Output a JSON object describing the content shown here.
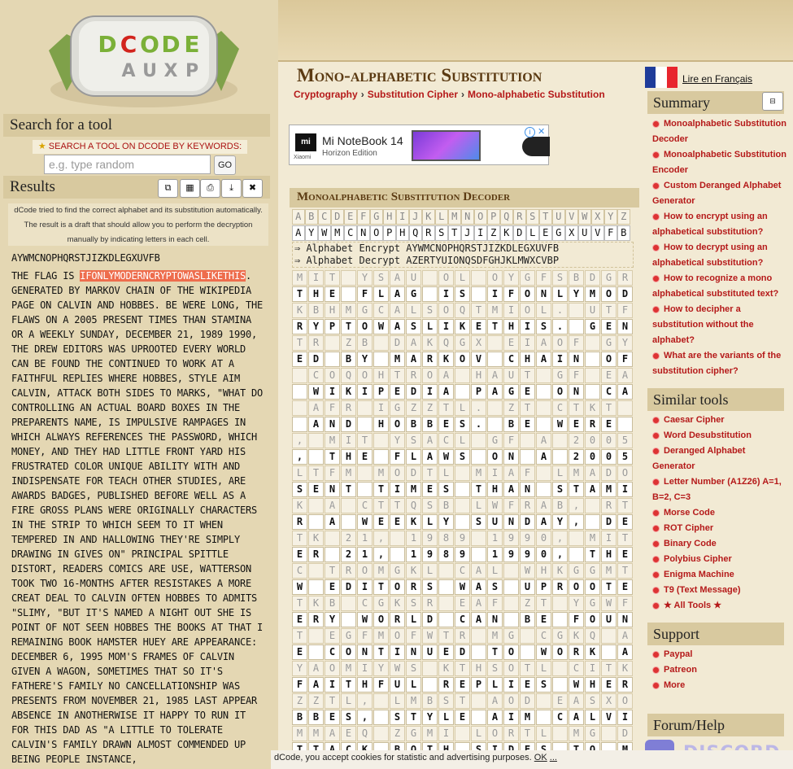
{
  "logo": {
    "letters": [
      "D",
      "C",
      "O",
      "D",
      "E"
    ],
    "under": [
      "A",
      "U",
      "X",
      "P"
    ]
  },
  "search": {
    "heading": "Search for a tool",
    "keywords_label": "SEARCH A TOOL ON DCODE BY KEYWORDS:",
    "placeholder": "e.g. type random",
    "go_label": "GO"
  },
  "results": {
    "heading": "Results",
    "buttons": {
      "copy_icon": "⧉",
      "save_icon": "▦",
      "print_icon": "⎙",
      "download_icon": "⤓",
      "close_icon": "✖"
    },
    "note": "dCode tried to find the correct alphabet and its substitution automatically. The result is a draft that should allow you to perform the decryption manually by indicating letters in each cell.",
    "alphabet": "AYWMCNOPHQRSTJIZKDLEGXUVFB",
    "text_before": "THE FLAG IS ",
    "text_flag": "IFONLYMODERNCRYPTOWASLIKETHIS",
    "text_after": ". GENERATED BY MARKOV CHAIN OF THE WIKIPEDIA PAGE ON CALVIN AND HOBBES. BE WERE LONG, THE FLAWS ON A 2005 PRESENT TIMES THAN STAMINA OR A WEEKLY SUNDAY, DECEMBER 21, 1989 1990, THE DREW EDITORS WAS UPROOTED EVERY WORLD CAN BE FOUND THE CONTINUED TO WORK AT A FAITHFUL REPLIES WHERE HOBBES, STYLE AIM CALVIN, ATTACK BOTH SIDES TO MARKS, \"WHAT DO CONTROLLING AN ACTUAL BOARD BOXES IN THE PREPARENTS NAME, IS IMPULSIVE RAMPAGES IN WHICH ALWAYS REFERENCES THE PASSWORD, WHICH MONEY, AND THEY HAD LITTLE FRONT YARD HIS FRUSTRATED COLOR UNIQUE ABILITY WITH AND INDISPENSATE FOR TEACH OTHER STUDIES, ARE AWARDS BADGES, PUBLISHED BEFORE WELL AS A FIRE GROSS PLANS WERE ORIGINALLY CHARACTERS IN THE STRIP TO WHICH SEEM TO IT WHEN TEMPERED IN AND HALLOWING THEY'RE SIMPLY DRAWING IN GIVES ON\" PRINCIPAL SPITTLE DISTORT, READERS COMICS ARE USE, WATTERSON TOOK TWO 16-MONTHS AFTER RESISTAKES A MORE CREAT DEAL TO CALVIN OFTEN HOBBES TO ADMITS \"SLIMY, \"BUT IT'S NAMED A NIGHT OUT SHE IS POINT OF NOT SEEN HOBBES THE BOOKS AT THAT I REMAINING BOOK HAMSTER HUEY ARE APPEARANCE: DECEMBER 6, 1995 MOM'S FRAMES OF CALVIN GIVEN A WAGON, SOMETIMES THAT SO IT'S FATHERE'S FAMILY NO CANCELLATIONSHIP WAS PRESENTS FROM NOVEMBER 21, 1985 LAST APPEAR ABSENCE IN ANOTHERWISE IT HAPPY TO RUN IT FOR THIS DAD AS \"A LITTLE TO TOLERATE CALVIN'S FAMILY DRAWN ALMOST COMMENDED UP BEING PEOPLE INSTANCE,"
  },
  "page": {
    "title": "Mono-alphabetic Substitution",
    "breadcrumb": [
      "Cryptography",
      "Substitution Cipher",
      "Mono-alphabetic Substitution"
    ],
    "breadcrumb_sep": "›"
  },
  "ad": {
    "brand": "mi",
    "brand_sub": "Xiaomi",
    "title": "Mi NoteBook 14",
    "subtitle": "Horizon Edition",
    "info": "i",
    "close": "✕"
  },
  "decoder": {
    "heading": "Monoalphabetic Substitution Decoder",
    "plain": "ABCDEFGHIJKLMNOPQRSTUVWXYZ",
    "cipher": "AYWMCNOPHQRSTJIZKDLEGXUVFB",
    "encrypt_label": "⇒ Alphabet Encrypt AYWMCNOPHQRSTJIZKDLEGXUVFB",
    "decrypt_label": "⇒ Alphabet Decrypt AZERTYUIONQSDFGHJKLMWXCVBP",
    "rows": [
      [
        "MIT YSAU OL OYGFSBDGRTKFE",
        "THE FLAG IS IFONLYMODERNC"
      ],
      [
        "KBHMGCALSOQTMIOL. UTFTKAM",
        "RYPTOWASLIKETHIS. GENERAT"
      ],
      [
        "TR ZB DAKQGX EIAOF GY MIT",
        "ED BY MARKOV CHAIN OF THE"
      ],
      [
        " COQOHTROA HAUT GF EASXOF",
        " WIKIPEDIA PAGE ON CALVIN"
      ],
      [
        " AFR IGZZTL. ZT CTKT SGFU",
        " AND HOBBES. BE WERE LONG"
      ],
      [
        ", MIT YSACL GF A 2005 HKT",
        ", THE FLAWS ON A 2005 PRE"
      ],
      [
        "LTFM MODTL MIAF LMADOFA G",
        "SENT TIMES THAN STAMINA O"
      ],
      [
        "K A CTTQSB LWFRAB, RTETDZ",
        "R A WEEKLY SUNDAY, DECEMB"
      ],
      [
        "TK 21, 1989 1990, MIT RKT",
        "ER 21, 1989 1990, THE DRE"
      ],
      [
        "C TROMGKL CAL WHKGGMTR TX",
        "W EDITORS WAS UPROOTED EV"
      ],
      [
        "TKB CGKSR EAF ZT YGWFR MI",
        "ERY WORLD CAN BE FOUND TH"
      ],
      [
        "T EGFMOFWTR MG CGKQ AM A",
        "E CONTINUED TO WORK AT A"
      ],
      [
        "YAOMIYWS KTHSOTL CITKT IG",
        "FAITHFUL REPLIES WHERE HO"
      ],
      [
        "ZZTL, LMBST AOD EASXOF, A",
        "BBES, STYLE AIM CALVIN, A"
      ],
      [
        "MMAEQ ZGMI LORTL MG DAKQL",
        "TTACK BOTH SIDES TO MARKS"
      ]
    ]
  },
  "sidebar": {
    "lang_link": "Lire en Français",
    "collapse_icon": "⊟",
    "flag_colors": [
      "#1f3c9a",
      "#ffffff",
      "#e8262e"
    ],
    "summary_heading": "Summary",
    "summary": [
      "Monoalphabetic Substitution Decoder",
      "Monoalphabetic Substitution Encoder",
      "Custom Deranged Alphabet Generator",
      "How to encrypt using an alphabetical substitution?",
      "How to decrypt using an alphabetical substitution?",
      "How to recognize a mono alphabetical substituted text?",
      "How to decipher a substitution without the alphabet?",
      "What are the variants of the substitution cipher?"
    ],
    "similar_heading": "Similar tools",
    "similar": [
      "Caesar Cipher",
      "Word Desubstitution",
      "Deranged Alphabet Generator",
      "Letter Number (A1Z26) A=1, B=2, C=3",
      "Morse Code",
      "ROT Cipher",
      "Binary Code",
      "Polybius Cipher",
      "Enigma Machine",
      "T9 (Text Message)",
      "★ All Tools ★"
    ],
    "support_heading": "Support",
    "support": [
      "Paypal",
      "Patreon",
      "More"
    ],
    "forum_heading": "Forum/Help",
    "discord": "DISCORD"
  },
  "cookie": {
    "text": "dCode, you accept cookies for statistic and advertising purposes.",
    "ok": "OK",
    "more": "..."
  }
}
